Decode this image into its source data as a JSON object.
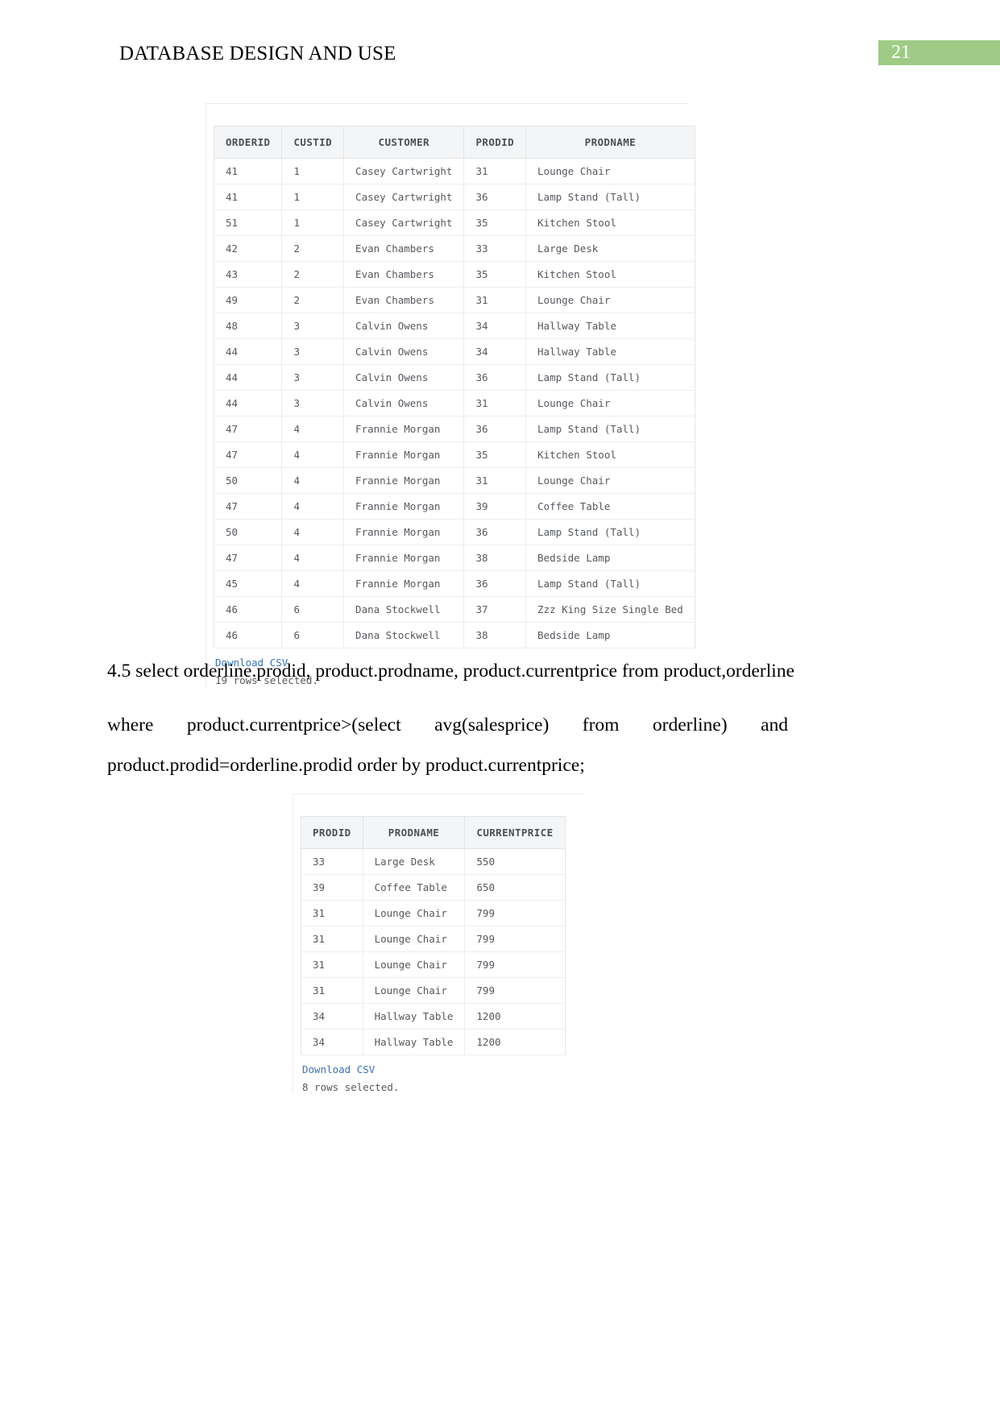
{
  "header": {
    "title": "DATABASE DESIGN AND USE",
    "page_number": "21",
    "badge_color": "#9fcb86"
  },
  "result_1": {
    "columns": [
      "ORDERID",
      "CUSTID",
      "CUSTOMER",
      "PRODID",
      "PRODNAME"
    ],
    "rows": [
      [
        "41",
        "1",
        "Casey Cartwright",
        "31",
        "Lounge Chair"
      ],
      [
        "41",
        "1",
        "Casey Cartwright",
        "36",
        "Lamp Stand (Tall)"
      ],
      [
        "51",
        "1",
        "Casey Cartwright",
        "35",
        "Kitchen Stool"
      ],
      [
        "42",
        "2",
        "Evan Chambers",
        "33",
        "Large Desk"
      ],
      [
        "43",
        "2",
        "Evan Chambers",
        "35",
        "Kitchen Stool"
      ],
      [
        "49",
        "2",
        "Evan Chambers",
        "31",
        "Lounge Chair"
      ],
      [
        "48",
        "3",
        "Calvin Owens",
        "34",
        "Hallway Table"
      ],
      [
        "44",
        "3",
        "Calvin Owens",
        "34",
        "Hallway Table"
      ],
      [
        "44",
        "3",
        "Calvin Owens",
        "36",
        "Lamp Stand (Tall)"
      ],
      [
        "44",
        "3",
        "Calvin Owens",
        "31",
        "Lounge Chair"
      ],
      [
        "47",
        "4",
        "Frannie Morgan",
        "36",
        "Lamp Stand (Tall)"
      ],
      [
        "47",
        "4",
        "Frannie Morgan",
        "35",
        "Kitchen Stool"
      ],
      [
        "50",
        "4",
        "Frannie Morgan",
        "31",
        "Lounge Chair"
      ],
      [
        "47",
        "4",
        "Frannie Morgan",
        "39",
        "Coffee Table"
      ],
      [
        "50",
        "4",
        "Frannie Morgan",
        "36",
        "Lamp Stand (Tall)"
      ],
      [
        "47",
        "4",
        "Frannie Morgan",
        "38",
        "Bedside Lamp"
      ],
      [
        "45",
        "4",
        "Frannie Morgan",
        "36",
        "Lamp Stand (Tall)"
      ],
      [
        "46",
        "6",
        "Dana Stockwell",
        "37",
        "Zzz King Size Single Bed"
      ],
      [
        "46",
        "6",
        "Dana Stockwell",
        "38",
        "Bedside Lamp"
      ]
    ],
    "download_label": "Download CSV",
    "rows_selected": "19 rows selected."
  },
  "query": {
    "line_1": "4.5 select orderline.prodid, product.prodname, product.currentprice from product,orderline",
    "line_2_words": [
      "where",
      "product.currentprice>(select",
      "avg(salesprice)",
      "from",
      "orderline)",
      "and"
    ],
    "line_3": "product.prodid=orderline.prodid order by product.currentprice;"
  },
  "result_2": {
    "columns": [
      "PRODID",
      "PRODNAME",
      "CURRENTPRICE"
    ],
    "rows": [
      [
        "33",
        "Large Desk",
        "550"
      ],
      [
        "39",
        "Coffee Table",
        "650"
      ],
      [
        "31",
        "Lounge Chair",
        "799"
      ],
      [
        "31",
        "Lounge Chair",
        "799"
      ],
      [
        "31",
        "Lounge Chair",
        "799"
      ],
      [
        "31",
        "Lounge Chair",
        "799"
      ],
      [
        "34",
        "Hallway Table",
        "1200"
      ],
      [
        "34",
        "Hallway Table",
        "1200"
      ]
    ],
    "download_label": "Download CSV",
    "rows_selected": "8 rows selected."
  }
}
